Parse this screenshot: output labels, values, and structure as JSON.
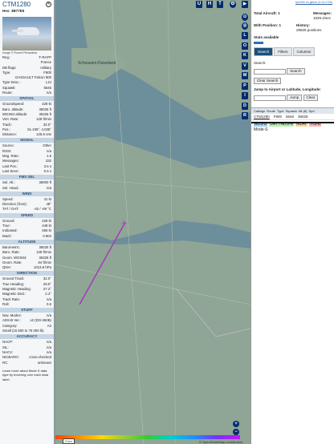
{
  "sidebar": {
    "callsign": "CTM1280",
    "hex_label": "Hex:",
    "hex": "3B77E5",
    "close_glyph": "✕",
    "photo_credit": "Image © Florent Peraudeau",
    "info": [
      [
        "Reg.:",
        "F-RAFP"
      ],
      [
        "",
        "France"
      ],
      [
        "DB flags:",
        "military"
      ],
      [
        "Type:",
        "F900"
      ],
      [
        "",
        "DASSAULT Falcon 900"
      ],
      [
        "Type Desc.:",
        "L2J"
      ],
      [
        "Squawk:",
        "5646"
      ],
      [
        "Route:",
        "n/a"
      ]
    ],
    "signal_h": "SPATIAL",
    "spatial": [
      [
        "Groundspeed:",
        "428 kt"
      ],
      [
        "Baro. altitude:",
        "36025 ft"
      ],
      [
        "WGS84 altitude:",
        "36325 ft"
      ],
      [
        "Vert. Rate:",
        "128 ft/min"
      ],
      [
        "Track:",
        "32.0°"
      ],
      [
        "Pos.:",
        "51.439°, 4.035°"
      ],
      [
        "Distance:",
        "125.5 nmi"
      ]
    ],
    "signal_title": "SIGNAL",
    "signal": [
      [
        "Source:",
        "Other"
      ],
      [
        "RSSI:",
        "n/a"
      ],
      [
        "Msg. Rate:",
        "1.5"
      ],
      [
        "Messages:",
        "332"
      ],
      [
        "Last Pos.:",
        "3.6 s"
      ],
      [
        "Last Seen:",
        "0.6 s"
      ]
    ],
    "fms_title": "FMS SEL",
    "fms": [
      [
        "Sel. Alt.:",
        "36000 ft"
      ],
      [
        "Sel. Head.:",
        "n/a"
      ]
    ],
    "wind_title": "WIND",
    "wind": [
      [
        "Speed:",
        "41 kt"
      ],
      [
        "Direction (from):",
        "48°"
      ],
      [
        "TAT / OAT:",
        "-42 / -69 °C"
      ]
    ],
    "speed_title": "SPEED",
    "speed": [
      [
        "Ground:",
        "428 kt"
      ],
      [
        "True:",
        "448 kt"
      ],
      [
        "Indicated:",
        "266 kt"
      ],
      [
        "Mach:",
        "0.804"
      ]
    ],
    "alt_title": "ALTITUDE",
    "alt": [
      [
        "Barometric:",
        "36025 ft"
      ],
      [
        "Baro. Rate:",
        "128 ft/min"
      ],
      [
        "Geom. WGS84:",
        "36325 ft"
      ],
      [
        "Geom. Rate:",
        "64 ft/min"
      ],
      [
        "QNH:",
        "1013.6 hPa"
      ]
    ],
    "dir_title": "DIRECTION",
    "dir": [
      [
        "Ground Track:",
        "32.0°"
      ],
      [
        "True Heading:",
        "29.5°"
      ],
      [
        "Magnetic Heading:",
        "27.2°"
      ],
      [
        "Magnetic Decl.:",
        "2.4°"
      ],
      [
        "Track Rate:",
        "n/a"
      ],
      [
        "Roll:",
        "0.5"
      ]
    ],
    "stuff_title": "STUFF",
    "stuff": [
      [
        "Nav. Modes:",
        "n/a"
      ],
      [
        "ADS-B Ver.:",
        "v2 (DO-260B)"
      ],
      [
        "Category:",
        "A2"
      ],
      [
        "Small (15 500 to 75 000 lb)",
        ""
      ]
    ],
    "acc_title": "ACCURACY",
    "acc": [
      [
        "NACP:",
        "n/a"
      ],
      [
        "SIL:",
        "n/a"
      ],
      [
        "NACV:",
        "n/a"
      ],
      [
        "NICBARO:",
        "cross-checked"
      ],
      [
        "RC:",
        "unknown"
      ]
    ],
    "footer": "Learn more about Mode S data type by hovering over each data label."
  },
  "map": {
    "top_buttons": [
      "U",
      "H",
      "T"
    ],
    "side_buttons": [
      "L",
      "O",
      "K",
      "V",
      "M",
      "P",
      "I",
      "D",
      "R"
    ],
    "scale": "2 km",
    "attribution": "© OpenStreetMap contributors.",
    "place1": "Schouwen-Duiveland"
  },
  "panel": {
    "top_link": "tar1090 on github (3.14.1725)",
    "aircraft_label": "Total Aircraft:",
    "aircraft": "1",
    "msg_label": "Messages:",
    "msg": "1529.4/sec",
    "pos_label": "With Position:",
    "pos": "1",
    "hist_label": "History:",
    "hist": "28825 positions",
    "stats": "Stats available",
    "tabs": [
      "Search",
      "Filters",
      "Columns"
    ],
    "search_label": "Search:",
    "search_btn": "Search",
    "clear_btn": "Clear Search",
    "jump_label": "Jump to Airport or Latitude, Longitude:",
    "jump_btn": "Jump",
    "clear2_btn": "Clear",
    "cols": [
      "Callsign",
      "Route",
      "Type",
      "Squawk",
      "Alt (ft)",
      "Spd"
    ],
    "row": [
      "CTM1280",
      "F900",
      "5646",
      "36025"
    ],
    "badges": [
      "ADS-B",
      "UAT / ADS-R",
      "MLAT",
      "TIS-B"
    ],
    "mode": "Mode-S"
  }
}
